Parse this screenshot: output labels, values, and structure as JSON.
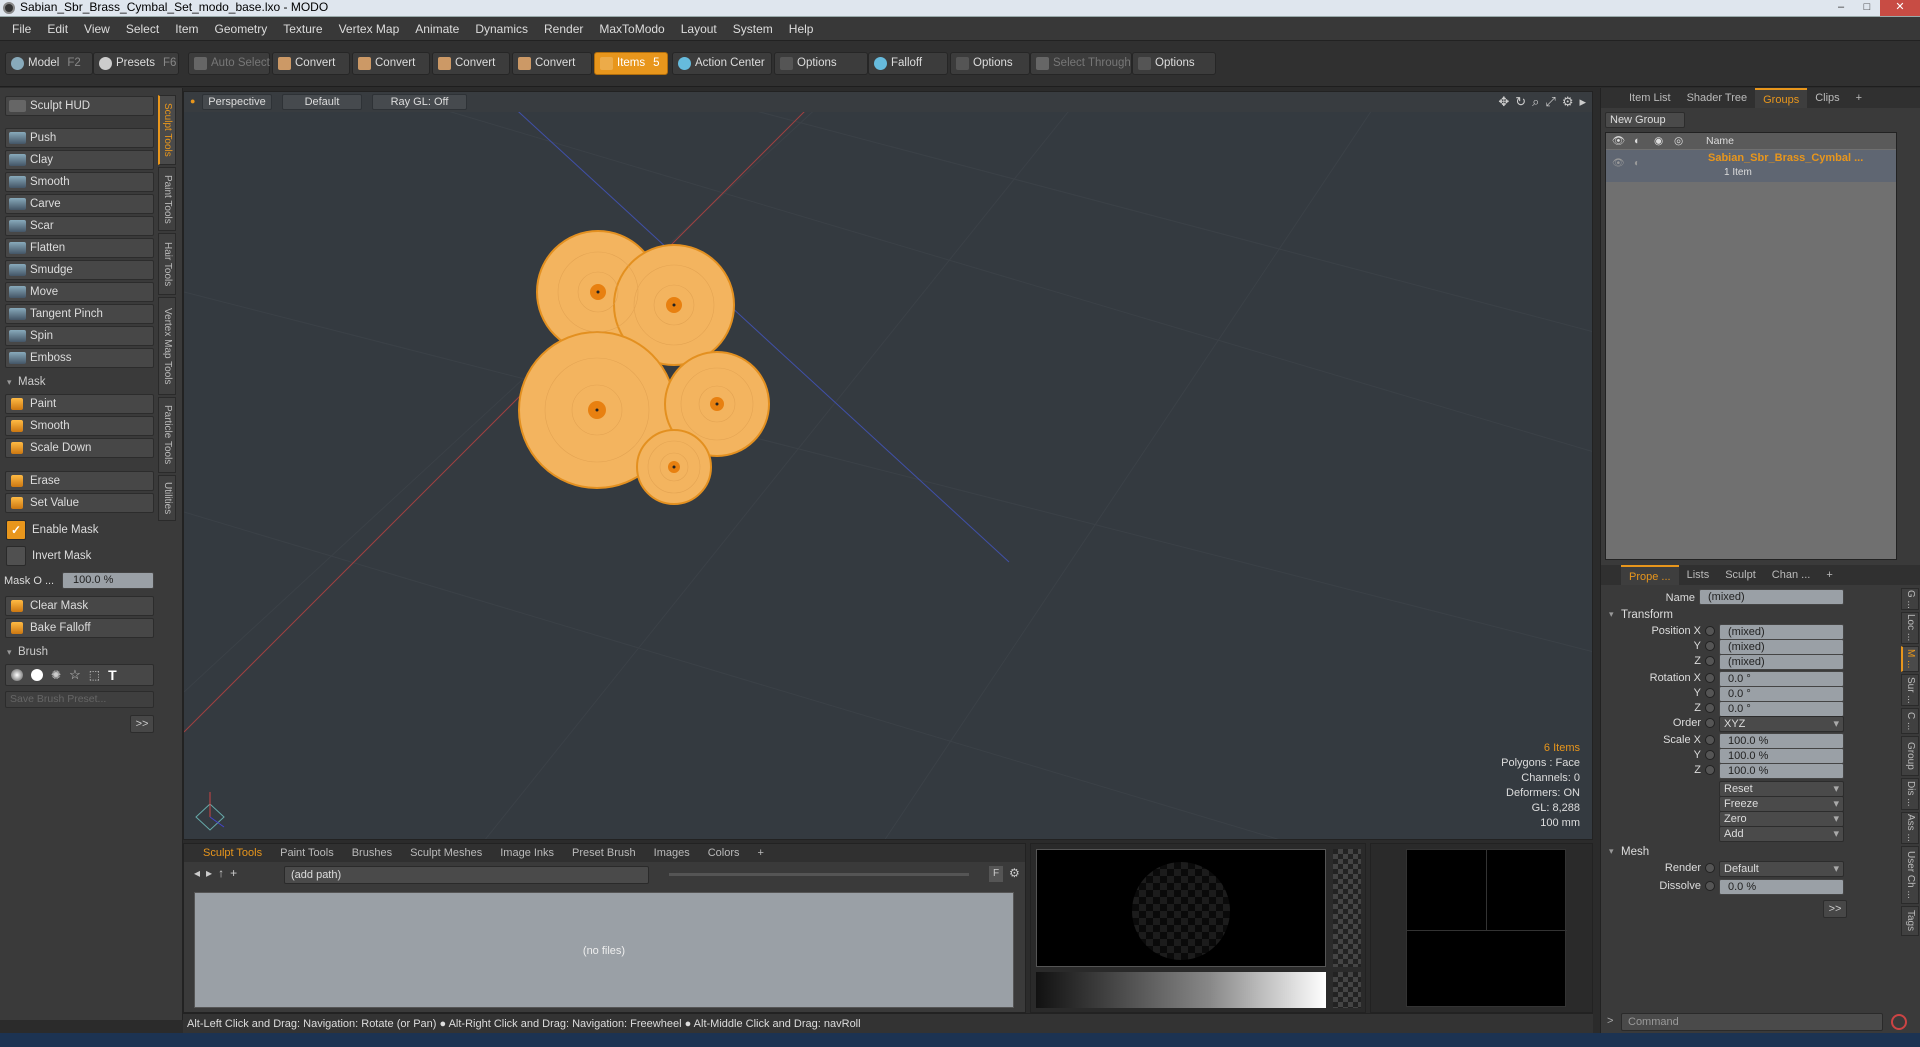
{
  "window": {
    "title": "Sabian_Sbr_Brass_Cymbal_Set_modo_base.lxo - MODO",
    "min": "–",
    "max": "□",
    "close": "✕"
  },
  "menu": [
    "File",
    "Edit",
    "View",
    "Select",
    "Item",
    "Geometry",
    "Texture",
    "Vertex Map",
    "Animate",
    "Dynamics",
    "Render",
    "MaxToModo",
    "Layout",
    "System",
    "Help"
  ],
  "toolbar": {
    "model": "Model",
    "model_key": "F2",
    "presets": "Presets",
    "presets_key": "F6",
    "auto_select": "Auto Select",
    "convert1": "Convert",
    "convert2": "Convert",
    "convert3": "Convert",
    "convert4": "Convert",
    "items": "Items",
    "items_key": "5",
    "action_center": "Action Center",
    "options1": "Options",
    "falloff": "Falloff",
    "options2": "Options",
    "select_through": "Select Through",
    "options3": "Options"
  },
  "left": {
    "hud": "Sculpt HUD",
    "tools": [
      "Push",
      "Clay",
      "Smooth",
      "Carve",
      "Scar",
      "Flatten",
      "Smudge",
      "Move",
      "Tangent Pinch",
      "Spin",
      "Emboss"
    ],
    "mask_section": "Mask",
    "mask_tools": [
      "Paint",
      "Smooth",
      "Scale Down"
    ],
    "mask_tools2": [
      "Erase",
      "Set Value"
    ],
    "enable_mask": "Enable Mask",
    "enable_mask_check": "✓",
    "invert_mask": "Invert Mask",
    "mask_opacity_label": "Mask O ...",
    "mask_opacity_value": "100.0 %",
    "clear_mask": "Clear Mask",
    "bake_falloff": "Bake Falloff",
    "brush_section": "Brush",
    "save_brush": "Save Brush Preset...",
    "more": ">>",
    "vtabs": [
      "Sculpt Tools",
      "Paint Tools",
      "Hair Tools",
      "Vertex Map Tools",
      "Particle Tools",
      "Utilities"
    ]
  },
  "viewport": {
    "view": "Perspective",
    "shading": "Default",
    "raygl": "Ray GL: Off",
    "stats": [
      "6 Items",
      "Polygons : Face",
      "Channels: 0",
      "Deformers: ON",
      "GL: 8,288",
      "100 mm"
    ]
  },
  "bottom": {
    "tabs": [
      "Sculpt Tools",
      "Paint Tools",
      "Brushes",
      "Sculpt Meshes",
      "Image Inks",
      "Preset Brush",
      "Images",
      "Colors",
      "+"
    ],
    "path": "(add path)",
    "nofiles": "(no files)",
    "f_btn": "F"
  },
  "status": "Alt-Left Click and Drag: Navigation: Rotate (or Pan) ● Alt-Right Click and Drag: Navigation: Freewheel ● Alt-Middle Click and Drag: navRoll",
  "right": {
    "top_tabs": [
      "Item List",
      "Shader Tree",
      "Groups",
      "Clips",
      "+"
    ],
    "new_group": "New Group",
    "name_col": "Name",
    "group_name": "Sabian_Sbr_Brass_Cymbal ...",
    "group_count": "1 Item",
    "prop_tabs": [
      "Prope ...",
      "Lists",
      "Sculpt",
      "Chan ...",
      "+"
    ],
    "name_label": "Name",
    "name_value": "(mixed)",
    "transform": "Transform",
    "pos_x_label": "Position X",
    "pos_x": "(mixed)",
    "pos_y_label": "Y",
    "pos_y": "(mixed)",
    "pos_z_label": "Z",
    "pos_z": "(mixed)",
    "rot_x_label": "Rotation X",
    "rot_x": "0.0 °",
    "rot_y_label": "Y",
    "rot_y": "0.0 °",
    "rot_z_label": "Z",
    "rot_z": "0.0 °",
    "order_label": "Order",
    "order": "XYZ",
    "scale_x_label": "Scale X",
    "scale_x": "100.0 %",
    "scale_y_label": "Y",
    "scale_y": "100.0 %",
    "scale_z_label": "Z",
    "scale_z": "100.0 %",
    "reset": "Reset",
    "freeze": "Freeze",
    "zero": "Zero",
    "add": "Add",
    "mesh": "Mesh",
    "render_label": "Render",
    "render": "Default",
    "dissolve_label": "Dissolve",
    "dissolve": "0.0 %",
    "more": ">>",
    "side_tabs": [
      "G ...",
      "Loc ...",
      "M ...",
      "Sur ...",
      "C ...",
      "Group",
      "Dis ...",
      "Ass ...",
      "User Ch ...",
      "Tags"
    ],
    "command": "Command",
    "cmd_prompt": ">"
  }
}
